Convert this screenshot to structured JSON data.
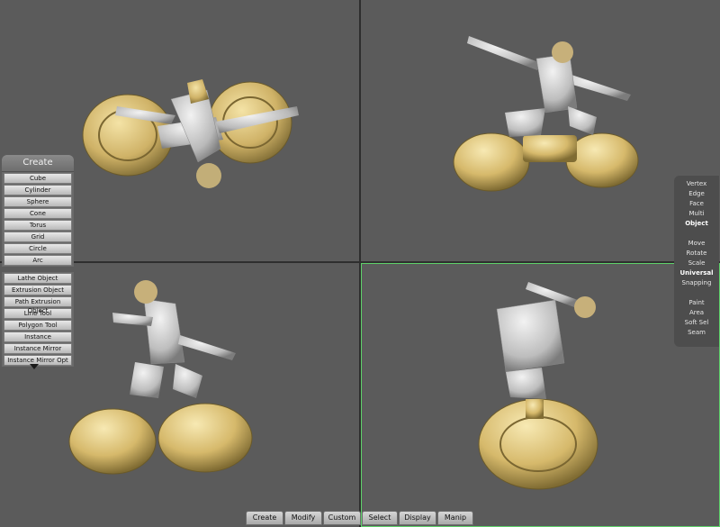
{
  "create_panel": {
    "title": "Create",
    "primitives": [
      "Cube",
      "Cylinder",
      "Sphere",
      "Cone",
      "Torus",
      "Grid",
      "Circle",
      "Arc"
    ],
    "tools": [
      "Lathe Object",
      "Extrusion Object",
      "Path Extrusion Object",
      "Line Tool",
      "Polygon Tool",
      "Instance",
      "Instance Mirror",
      "Instance Mirror Opt"
    ]
  },
  "mode_panel": {
    "selection": [
      "Vertex",
      "Edge",
      "Face",
      "Multi",
      "Object"
    ],
    "transform": [
      "Move",
      "Rotate",
      "Scale",
      "Universal",
      "Snapping"
    ],
    "paint": [
      "Paint",
      "Area",
      "Soft Sel",
      "Seam"
    ],
    "active_selection": "Object",
    "active_transform": "Universal"
  },
  "bottom_tabs": {
    "create": "Create",
    "modify": "Modify",
    "custom": "Custom",
    "select": "Select",
    "display": "Display",
    "manip": "Manip"
  },
  "colors": {
    "viewport_bg": "#5b5b5b",
    "active_viewport_border": "#5ed16a",
    "model_gold": "#d8c07a",
    "model_silver": "#c9c9c9"
  }
}
